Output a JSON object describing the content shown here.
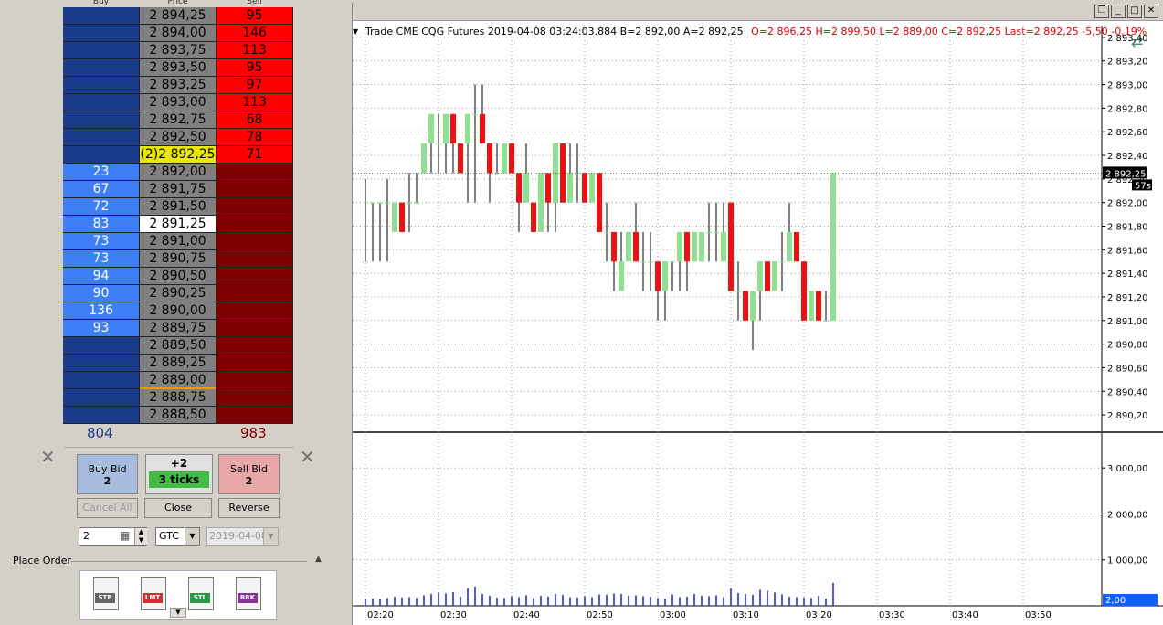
{
  "dom": {
    "headers": {
      "buy": "Buy",
      "price": "Price",
      "sell": "Sell"
    },
    "rows": [
      {
        "buy": "",
        "price": "2 894,25",
        "sell": "95",
        "type": "ask"
      },
      {
        "buy": "",
        "price": "2 894,00",
        "sell": "146",
        "type": "ask"
      },
      {
        "buy": "",
        "price": "2 893,75",
        "sell": "113",
        "type": "ask"
      },
      {
        "buy": "",
        "price": "2 893,50",
        "sell": "95",
        "type": "ask"
      },
      {
        "buy": "",
        "price": "2 893,25",
        "sell": "97",
        "type": "ask"
      },
      {
        "buy": "",
        "price": "2 893,00",
        "sell": "113",
        "type": "ask"
      },
      {
        "buy": "",
        "price": "2 892,75",
        "sell": "68",
        "type": "ask"
      },
      {
        "buy": "",
        "price": "2 892,50",
        "sell": "78",
        "type": "ask"
      },
      {
        "buy": "",
        "price": "(2)2 892,25",
        "sell": "71",
        "type": "last"
      },
      {
        "buy": "23",
        "price": "2 892,00",
        "sell": "",
        "type": "bid"
      },
      {
        "buy": "67",
        "price": "2 891,75",
        "sell": "",
        "type": "bid"
      },
      {
        "buy": "72",
        "price": "2 891,50",
        "sell": "",
        "type": "bid"
      },
      {
        "buy": "83",
        "price": "2 891,25",
        "sell": "",
        "type": "bidcur"
      },
      {
        "buy": "73",
        "price": "2 891,00",
        "sell": "",
        "type": "bid"
      },
      {
        "buy": "73",
        "price": "2 890,75",
        "sell": "",
        "type": "bid"
      },
      {
        "buy": "94",
        "price": "2 890,50",
        "sell": "",
        "type": "bid"
      },
      {
        "buy": "90",
        "price": "2 890,25",
        "sell": "",
        "type": "bid"
      },
      {
        "buy": "136",
        "price": "2 890,00",
        "sell": "",
        "type": "bid"
      },
      {
        "buy": "93",
        "price": "2 889,75",
        "sell": "",
        "type": "bid"
      },
      {
        "buy": "",
        "price": "2 889,50",
        "sell": "",
        "type": "empty"
      },
      {
        "buy": "",
        "price": "2 889,25",
        "sell": "",
        "type": "empty"
      },
      {
        "buy": "",
        "price": "2 889,00",
        "sell": "",
        "type": "empty"
      },
      {
        "buy": "",
        "price": "2 888,75",
        "sell": "",
        "type": "empty"
      },
      {
        "buy": "",
        "price": "2 888,50",
        "sell": "",
        "type": "empty"
      }
    ],
    "total_buy": "804",
    "total_sell": "983"
  },
  "order_panel": {
    "buy_bid_label": "Buy Bid",
    "buy_bid_qty": "2",
    "position": "+2",
    "ticks": "3 ticks",
    "sell_bid_label": "Sell Bid",
    "sell_bid_qty": "2",
    "cancel_all": "Cancel All",
    "close": "Close",
    "reverse": "Reverse",
    "quantity": "2",
    "tif": "GTC",
    "date": "2019-04-08",
    "place_order_label": "Place Order",
    "order_types": [
      "STP",
      "LMT",
      "STL",
      "BRK"
    ]
  },
  "chart": {
    "info_prefix": "Trade  CME  CQG  Futures  2019-04-08  03:24:03.884  B=2 892,00  A=2 892,25",
    "info_red": "O=2 896,25  H=2 899,50  L=2 889,00  C=2 892,25  Last=2 892,25  -5,50  -0,19%",
    "price_ticks": [
      "2 893,40",
      "2 893,20",
      "2 893,00",
      "2 892,80",
      "2 892,60",
      "2 892,40",
      "2 892,20",
      "2 892,00",
      "2 891,80",
      "2 891,60",
      "2 891,40",
      "2 891,20",
      "2 891,00",
      "2 890,80",
      "2 890,60",
      "2 890,40",
      "2 890,20"
    ],
    "last_price_label": "2 892,25",
    "timer_label": "57s",
    "volume_ticks": [
      "3 000,00",
      "2 000,00",
      "1 000,00"
    ],
    "volume_last_label": "2,00",
    "time_ticks": [
      "02:20",
      "02:30",
      "02:40",
      "02:50",
      "03:00",
      "03:10",
      "03:20",
      "03:30",
      "03:40",
      "03:50"
    ],
    "colors": {
      "up": "#90e090",
      "down": "#ee1111",
      "ask": "#ff0000",
      "bid": "#3f7ff5",
      "dark_blue": "#1a3a8a",
      "dark_red": "#800000",
      "price_bg": "#808080"
    }
  },
  "chart_data": {
    "type": "bar",
    "title": "",
    "xlabel": "",
    "ylabel": "",
    "ylim": [
      2890.1,
      2893.5
    ],
    "bars": [
      {
        "t": "02:20",
        "o": 2891.5,
        "h": 2892.2,
        "l": 2891.5,
        "c": 2891.5
      },
      {
        "t": "02:21",
        "o": 2892.0,
        "h": 2892.0,
        "l": 2891.5,
        "c": 2892.0
      },
      {
        "t": "02:22",
        "o": 2892.0,
        "h": 2892.0,
        "l": 2891.5,
        "c": 2892.0
      },
      {
        "t": "02:23",
        "o": 2892.0,
        "h": 2892.2,
        "l": 2891.5,
        "c": 2892.0
      },
      {
        "t": "02:24",
        "o": 2891.75,
        "h": 2892.0,
        "l": 2891.75,
        "c": 2892.0
      },
      {
        "t": "02:25",
        "o": 2892.0,
        "h": 2892.0,
        "l": 2891.75,
        "c": 2891.75
      },
      {
        "t": "02:26",
        "o": 2892.0,
        "h": 2892.25,
        "l": 2891.75,
        "c": 2892.0
      },
      {
        "t": "02:27",
        "o": 2892.0,
        "h": 2892.25,
        "l": 2892.0,
        "c": 2892.0
      },
      {
        "t": "02:28",
        "o": 2892.25,
        "h": 2892.5,
        "l": 2892.25,
        "c": 2892.5
      },
      {
        "t": "02:29",
        "o": 2892.5,
        "h": 2892.75,
        "l": 2892.25,
        "c": 2892.75
      },
      {
        "t": "02:30",
        "o": 2892.5,
        "h": 2892.75,
        "l": 2892.25,
        "c": 2892.5
      },
      {
        "t": "02:31",
        "o": 2892.5,
        "h": 2892.75,
        "l": 2892.25,
        "c": 2892.75
      },
      {
        "t": "02:32",
        "o": 2892.75,
        "h": 2892.75,
        "l": 2892.25,
        "c": 2892.5
      },
      {
        "t": "02:33",
        "o": 2892.5,
        "h": 2892.5,
        "l": 2892.25,
        "c": 2892.25
      },
      {
        "t": "02:34",
        "o": 2892.5,
        "h": 2892.75,
        "l": 2892.0,
        "c": 2892.75
      },
      {
        "t": "02:35",
        "o": 2892.75,
        "h": 2893.0,
        "l": 2892.0,
        "c": 2892.75
      },
      {
        "t": "02:36",
        "o": 2892.75,
        "h": 2893.0,
        "l": 2892.5,
        "c": 2892.5
      },
      {
        "t": "02:37",
        "o": 2892.5,
        "h": 2892.5,
        "l": 2892.0,
        "c": 2892.25
      },
      {
        "t": "02:38",
        "o": 2892.25,
        "h": 2892.5,
        "l": 2892.25,
        "c": 2892.25
      },
      {
        "t": "02:39",
        "o": 2892.25,
        "h": 2892.5,
        "l": 2892.25,
        "c": 2892.5
      },
      {
        "t": "02:40",
        "o": 2892.5,
        "h": 2892.5,
        "l": 2892.25,
        "c": 2892.25
      },
      {
        "t": "02:41",
        "o": 2892.25,
        "h": 2892.25,
        "l": 2891.75,
        "c": 2892.0
      },
      {
        "t": "02:42",
        "o": 2892.0,
        "h": 2892.5,
        "l": 2892.0,
        "c": 2892.25
      },
      {
        "t": "02:43",
        "o": 2892.0,
        "h": 2892.0,
        "l": 2891.75,
        "c": 2891.75
      },
      {
        "t": "02:44",
        "o": 2891.75,
        "h": 2892.25,
        "l": 2891.75,
        "c": 2892.25
      },
      {
        "t": "02:45",
        "o": 2892.25,
        "h": 2892.25,
        "l": 2891.75,
        "c": 2892.0
      },
      {
        "t": "02:46",
        "o": 2892.0,
        "h": 2892.5,
        "l": 2891.75,
        "c": 2892.5
      },
      {
        "t": "02:47",
        "o": 2892.5,
        "h": 2892.5,
        "l": 2892.0,
        "c": 2892.0
      },
      {
        "t": "02:48",
        "o": 2892.0,
        "h": 2892.5,
        "l": 2892.0,
        "c": 2892.25
      },
      {
        "t": "02:49",
        "o": 2892.25,
        "h": 2892.5,
        "l": 2892.0,
        "c": 2892.25
      },
      {
        "t": "02:50",
        "o": 2892.25,
        "h": 2892.25,
        "l": 2892.0,
        "c": 2892.0
      },
      {
        "t": "02:51",
        "o": 2892.0,
        "h": 2892.25,
        "l": 2892.0,
        "c": 2892.25
      },
      {
        "t": "02:52",
        "o": 2892.25,
        "h": 2892.25,
        "l": 2891.75,
        "c": 2891.75
      },
      {
        "t": "02:53",
        "o": 2891.75,
        "h": 2892.0,
        "l": 2891.5,
        "c": 2891.75
      },
      {
        "t": "02:54",
        "o": 2891.75,
        "h": 2891.75,
        "l": 2891.25,
        "c": 2891.5
      },
      {
        "t": "02:55",
        "o": 2891.25,
        "h": 2891.75,
        "l": 2891.25,
        "c": 2891.5
      },
      {
        "t": "02:56",
        "o": 2891.5,
        "h": 2891.75,
        "l": 2891.5,
        "c": 2891.75
      },
      {
        "t": "02:57",
        "o": 2891.75,
        "h": 2892.0,
        "l": 2891.5,
        "c": 2891.5
      },
      {
        "t": "02:58",
        "o": 2891.5,
        "h": 2891.75,
        "l": 2891.25,
        "c": 2891.5
      },
      {
        "t": "02:59",
        "o": 2891.5,
        "h": 2891.75,
        "l": 2891.25,
        "c": 2891.5
      },
      {
        "t": "03:00",
        "o": 2891.5,
        "h": 2891.5,
        "l": 2891.0,
        "c": 2891.25
      },
      {
        "t": "03:01",
        "o": 2891.25,
        "h": 2891.5,
        "l": 2891.0,
        "c": 2891.5
      },
      {
        "t": "03:02",
        "o": 2891.5,
        "h": 2891.5,
        "l": 2891.25,
        "c": 2891.5
      },
      {
        "t": "03:03",
        "o": 2891.5,
        "h": 2891.75,
        "l": 2891.25,
        "c": 2891.75
      },
      {
        "t": "03:04",
        "o": 2891.75,
        "h": 2891.75,
        "l": 2891.25,
        "c": 2891.5
      },
      {
        "t": "03:05",
        "o": 2891.5,
        "h": 2891.75,
        "l": 2891.5,
        "c": 2891.75
      },
      {
        "t": "03:06",
        "o": 2891.5,
        "h": 2891.75,
        "l": 2891.5,
        "c": 2891.75
      },
      {
        "t": "03:07",
        "o": 2891.75,
        "h": 2892.0,
        "l": 2891.5,
        "c": 2891.75
      },
      {
        "t": "03:08",
        "o": 2891.75,
        "h": 2892.0,
        "l": 2891.5,
        "c": 2891.75
      },
      {
        "t": "03:09",
        "o": 2891.5,
        "h": 2892.0,
        "l": 2891.5,
        "c": 2891.75
      },
      {
        "t": "03:10",
        "o": 2892.0,
        "h": 2892.0,
        "l": 2891.25,
        "c": 2891.25
      },
      {
        "t": "03:11",
        "o": 2891.25,
        "h": 2891.5,
        "l": 2891.0,
        "c": 2891.25
      },
      {
        "t": "03:12",
        "o": 2891.25,
        "h": 2891.25,
        "l": 2891.0,
        "c": 2891.0
      },
      {
        "t": "03:13",
        "o": 2891.0,
        "h": 2891.25,
        "l": 2890.75,
        "c": 2891.25
      },
      {
        "t": "03:14",
        "o": 2891.25,
        "h": 2891.5,
        "l": 2891.0,
        "c": 2891.5
      },
      {
        "t": "03:15",
        "o": 2891.5,
        "h": 2891.5,
        "l": 2891.25,
        "c": 2891.25
      },
      {
        "t": "03:16",
        "o": 2891.25,
        "h": 2891.5,
        "l": 2891.25,
        "c": 2891.5
      },
      {
        "t": "03:17",
        "o": 2891.5,
        "h": 2891.75,
        "l": 2891.25,
        "c": 2891.5
      },
      {
        "t": "03:18",
        "o": 2891.5,
        "h": 2892.0,
        "l": 2891.5,
        "c": 2891.75
      },
      {
        "t": "03:19",
        "o": 2891.75,
        "h": 2891.75,
        "l": 2891.5,
        "c": 2891.5
      },
      {
        "t": "03:20",
        "o": 2891.5,
        "h": 2891.5,
        "l": 2891.0,
        "c": 2891.0
      },
      {
        "t": "03:21",
        "o": 2891.0,
        "h": 2891.25,
        "l": 2891.0,
        "c": 2891.25
      },
      {
        "t": "03:22",
        "o": 2891.25,
        "h": 2891.25,
        "l": 2891.0,
        "c": 2891.0
      },
      {
        "t": "03:23",
        "o": 2891.0,
        "h": 2891.25,
        "l": 2891.0,
        "c": 2891.0
      },
      {
        "t": "03:24",
        "o": 2891.0,
        "h": 2892.25,
        "l": 2891.0,
        "c": 2892.25
      }
    ],
    "volume": [
      150,
      160,
      140,
      170,
      200,
      180,
      190,
      170,
      230,
      260,
      290,
      270,
      300,
      200,
      380,
      420,
      260,
      220,
      180,
      170,
      210,
      190,
      230,
      170,
      220,
      200,
      260,
      240,
      190,
      180,
      210,
      190,
      250,
      240,
      270,
      260,
      220,
      230,
      210,
      200,
      170,
      150,
      250,
      190,
      200,
      260,
      220,
      210,
      230,
      190,
      380,
      280,
      260,
      240,
      350,
      330,
      290,
      250,
      200,
      190,
      180,
      170,
      220,
      160,
      500
    ],
    "vol_ylim": [
      0,
      3700
    ]
  }
}
